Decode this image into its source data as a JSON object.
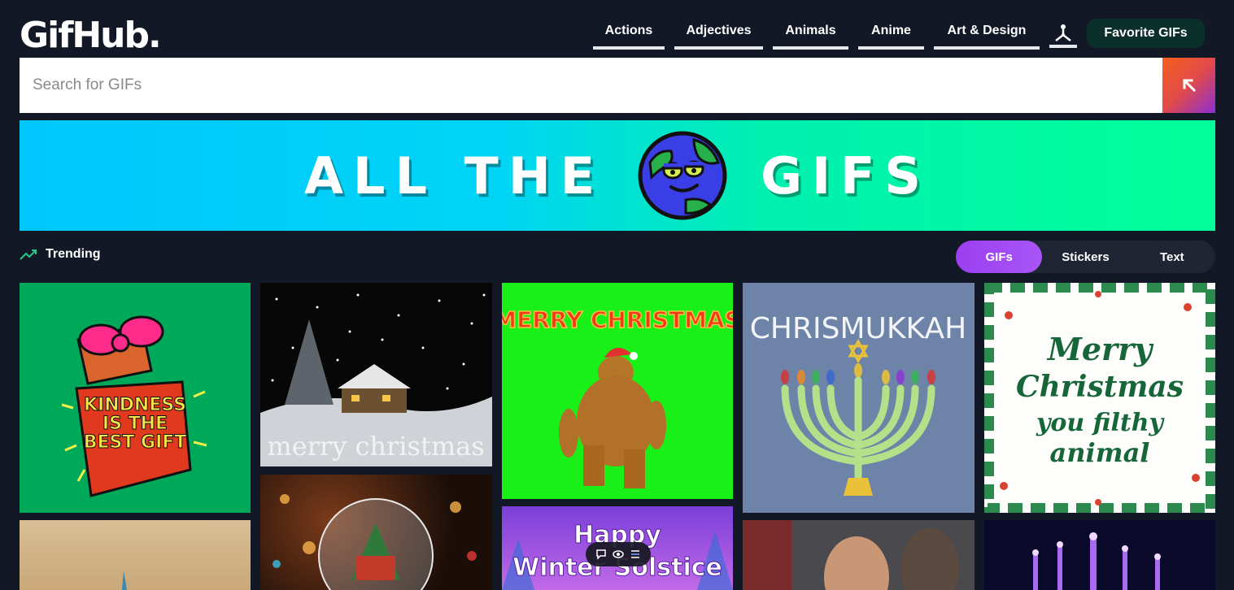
{
  "brand": {
    "logo": "GifHub."
  },
  "nav": {
    "items": [
      {
        "label": "Actions"
      },
      {
        "label": "Adjectives"
      },
      {
        "label": "Animals"
      },
      {
        "label": "Anime"
      },
      {
        "label": "Art & Design"
      }
    ],
    "favorite_label": "Favorite GIFs"
  },
  "search": {
    "placeholder": "Search for GIFs"
  },
  "banner": {
    "left_text": "ALL THE",
    "right_text": "GIFS"
  },
  "trending": {
    "label": "Trending"
  },
  "tabs": [
    {
      "label": "GIFs",
      "active": true
    },
    {
      "label": "Stickers",
      "active": false
    },
    {
      "label": "Text",
      "active": false
    }
  ],
  "gifs": [
    {
      "caption_lines": [
        "KINDNESS",
        "IS THE",
        "BEST GIFT"
      ]
    },
    {
      "caption": "merry christmas"
    },
    {
      "caption": "MERRY CHRISTMAS"
    },
    {
      "caption": "CHRISMUKKAH"
    },
    {
      "caption_lines": [
        "Merry",
        "Christmas",
        "you filthy",
        "animal"
      ]
    },
    {
      "caption_lines": [
        "Happy",
        "Winter Solstice"
      ]
    }
  ],
  "colors": {
    "background": "#121826",
    "accent_purple": "#a855f7",
    "favorite_bg": "#0b2f2b",
    "tile_green": "#00a859",
    "tile_lime": "#18f018",
    "tile_slate": "#6d84a8"
  }
}
